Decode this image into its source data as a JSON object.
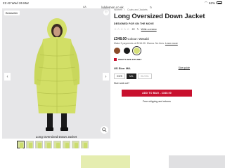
{
  "status": {
    "time": "21:42",
    "date": "Wed 26 Mar",
    "battery": "62%"
  },
  "browser": {
    "aa": "AA",
    "url": "lululemon.co.uk"
  },
  "gallery": {
    "badge": "Bestseller",
    "caption": "Long Oversized Down Jacket",
    "thumbnails": [
      1,
      2,
      3,
      4,
      5,
      6,
      7,
      8
    ],
    "active_thumbnail": 1
  },
  "breadcrumb": {
    "category": "Women",
    "sep": "/",
    "current": "Coats and Jackets"
  },
  "product": {
    "title": "Long Oversized Down Jacket",
    "subtitle": "DESIGNED FOR ON THE MOVE",
    "reviews": "22",
    "write_review": "Write a review",
    "price": "£348.00",
    "colour": "Colour: Wasabi",
    "klarna_text": "Make 3 payments of £116.00. Klarna. No fees.",
    "klarna_link": "Learn more",
    "swatches": [
      {
        "name": "brown",
        "color": "#8a4b2a"
      },
      {
        "name": "black",
        "color": "#1a1a1a"
      },
      {
        "name": "wasabi",
        "color": "#d6e07a"
      }
    ],
    "selected_swatch": 2,
    "fit_label": "WHAT'S SIZE FITS ME?",
    "size_label": "US Size: M/L",
    "size_guide": "Size guide",
    "sizes": [
      "XS/S",
      "M/L",
      "XL/XXL"
    ],
    "selected_size": "M/L",
    "sold_out_note": "Size sold out?",
    "add_button": "ADD TO BAG - £348.00",
    "shipping": "Free shipping and returns"
  },
  "colors": {
    "accent": "#c8102e",
    "wasabi": "#d6e07a"
  }
}
